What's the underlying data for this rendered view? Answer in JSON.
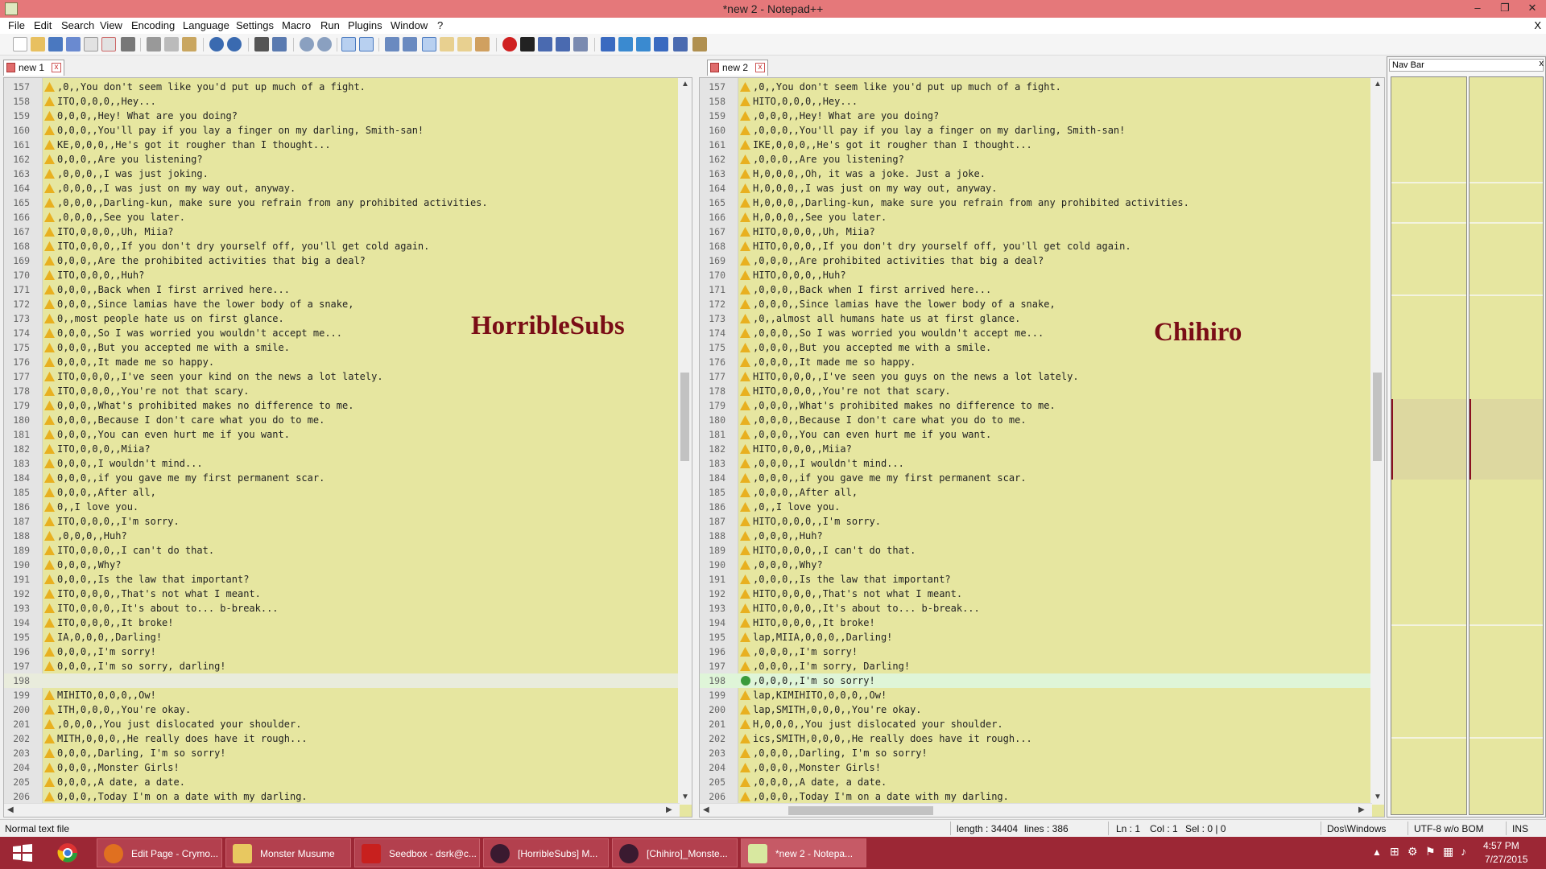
{
  "window": {
    "title": "*new  2 - Notepad++",
    "minimize": "–",
    "restore": "❐",
    "close": "✕"
  },
  "menu": {
    "items": [
      "File",
      "Edit",
      "Search",
      "View",
      "Encoding",
      "Language",
      "Settings",
      "Macro",
      "Run",
      "Plugins",
      "Window",
      "?"
    ],
    "close": "X"
  },
  "left": {
    "tab": "new  1",
    "overlay": "HorribleSubs",
    "lines": [
      {
        "n": "157",
        "t": ",0,,You don't seem like you'd put up much of a fight."
      },
      {
        "n": "158",
        "t": "ITO,0,0,0,,Hey..."
      },
      {
        "n": "159",
        "t": "0,0,0,,Hey! What are you doing?"
      },
      {
        "n": "160",
        "t": "0,0,0,,You'll pay if you lay a finger on my darling, Smith-san!"
      },
      {
        "n": "161",
        "t": "KE,0,0,0,,He's got it rougher than I thought..."
      },
      {
        "n": "162",
        "t": "0,0,0,,Are you listening?"
      },
      {
        "n": "163",
        "t": ",0,0,0,,I was just joking."
      },
      {
        "n": "164",
        "t": ",0,0,0,,I was just on my way out, anyway."
      },
      {
        "n": "165",
        "t": ",0,0,0,,Darling-kun, make sure you refrain from any prohibited activities."
      },
      {
        "n": "166",
        "t": ",0,0,0,,See you later."
      },
      {
        "n": "167",
        "t": "ITO,0,0,0,,Uh, Miia?"
      },
      {
        "n": "168",
        "t": "ITO,0,0,0,,If you don't dry yourself off, you'll get cold again."
      },
      {
        "n": "169",
        "t": "0,0,0,,Are the prohibited activities that big a deal?"
      },
      {
        "n": "170",
        "t": "ITO,0,0,0,,Huh?"
      },
      {
        "n": "171",
        "t": "0,0,0,,Back when I first arrived here..."
      },
      {
        "n": "172",
        "t": "0,0,0,,Since lamias have the lower body of a snake,"
      },
      {
        "n": "173",
        "t": "0,,most people hate us on first glance."
      },
      {
        "n": "174",
        "t": "0,0,0,,So I was worried you wouldn't accept me..."
      },
      {
        "n": "175",
        "t": "0,0,0,,But you accepted me with a smile."
      },
      {
        "n": "176",
        "t": "0,0,0,,It made me so happy."
      },
      {
        "n": "177",
        "t": "ITO,0,0,0,,I've seen your kind on the news a lot lately."
      },
      {
        "n": "178",
        "t": "ITO,0,0,0,,You're not that scary."
      },
      {
        "n": "179",
        "t": "0,0,0,,What's prohibited makes no difference to me."
      },
      {
        "n": "180",
        "t": "0,0,0,,Because I don't care what you do to me."
      },
      {
        "n": "181",
        "t": "0,0,0,,You can even hurt me if you want."
      },
      {
        "n": "182",
        "t": "ITO,0,0,0,,Miia?"
      },
      {
        "n": "183",
        "t": "0,0,0,,I wouldn't mind..."
      },
      {
        "n": "184",
        "t": "0,0,0,,if you gave me my first permanent scar."
      },
      {
        "n": "185",
        "t": "0,0,0,,After all,"
      },
      {
        "n": "186",
        "t": "0,,I love you."
      },
      {
        "n": "187",
        "t": "ITO,0,0,0,,I'm sorry."
      },
      {
        "n": "188",
        "t": ",0,0,0,,Huh?"
      },
      {
        "n": "189",
        "t": "ITO,0,0,0,,I can't do that."
      },
      {
        "n": "190",
        "t": "0,0,0,,Why?"
      },
      {
        "n": "191",
        "t": "0,0,0,,Is the law that important?"
      },
      {
        "n": "192",
        "t": "ITO,0,0,0,,That's not what I meant."
      },
      {
        "n": "193",
        "t": "ITO,0,0,0,,It's about to... b-break..."
      },
      {
        "n": "194",
        "t": "ITO,0,0,0,,It broke!"
      },
      {
        "n": "195",
        "t": "IA,0,0,0,,Darling!"
      },
      {
        "n": "196",
        "t": "0,0,0,,I'm sorry!"
      },
      {
        "n": "197",
        "t": "0,0,0,,I'm so sorry, darling!"
      },
      {
        "n": "198",
        "t": ""
      },
      {
        "n": "199",
        "t": "MIHITO,0,0,0,,Ow!"
      },
      {
        "n": "200",
        "t": "ITH,0,0,0,,You're okay."
      },
      {
        "n": "201",
        "t": ",0,0,0,,You just dislocated your shoulder."
      },
      {
        "n": "202",
        "t": "MITH,0,0,0,,He really does have it rough..."
      },
      {
        "n": "203",
        "t": "0,0,0,,Darling, I'm so sorry!"
      },
      {
        "n": "204",
        "t": "0,0,0,,Monster Girls!"
      },
      {
        "n": "205",
        "t": "0,0,0,,A date, a date."
      },
      {
        "n": "206",
        "t": "0,0,0,,Today I'm on a date with my darling."
      }
    ]
  },
  "right": {
    "tab": "new  2",
    "overlay": "Chihiro",
    "lines": [
      {
        "n": "157",
        "t": ",0,,You don't seem like you'd put up much of a fight."
      },
      {
        "n": "158",
        "t": "HITO,0,0,0,,Hey..."
      },
      {
        "n": "159",
        "t": ",0,0,0,,Hey! What are you doing?"
      },
      {
        "n": "160",
        "t": ",0,0,0,,You'll pay if you lay a finger on my darling, Smith-san!"
      },
      {
        "n": "161",
        "t": "IKE,0,0,0,,He's got it rougher than I thought..."
      },
      {
        "n": "162",
        "t": ",0,0,0,,Are you listening?"
      },
      {
        "n": "163",
        "t": "H,0,0,0,,Oh, it was a joke. Just a joke."
      },
      {
        "n": "164",
        "t": "H,0,0,0,,I was just on my way out, anyway."
      },
      {
        "n": "165",
        "t": "H,0,0,0,,Darling-kun, make sure you refrain from any prohibited activities."
      },
      {
        "n": "166",
        "t": "H,0,0,0,,See you later."
      },
      {
        "n": "167",
        "t": "HITO,0,0,0,,Uh, Miia?"
      },
      {
        "n": "168",
        "t": "HITO,0,0,0,,If you don't dry yourself off, you'll get cold again."
      },
      {
        "n": "169",
        "t": ",0,0,0,,Are prohibited activities that big a deal?"
      },
      {
        "n": "170",
        "t": "HITO,0,0,0,,Huh?"
      },
      {
        "n": "171",
        "t": ",0,0,0,,Back when I first arrived here..."
      },
      {
        "n": "172",
        "t": ",0,0,0,,Since lamias have the lower body of a snake,"
      },
      {
        "n": "173",
        "t": ",0,,almost all humans hate us at first glance."
      },
      {
        "n": "174",
        "t": ",0,0,0,,So I was worried you wouldn't accept me..."
      },
      {
        "n": "175",
        "t": ",0,0,0,,But you accepted me with a smile."
      },
      {
        "n": "176",
        "t": ",0,0,0,,It made me so happy."
      },
      {
        "n": "177",
        "t": "HITO,0,0,0,,I've seen you guys on the news a lot lately."
      },
      {
        "n": "178",
        "t": "HITO,0,0,0,,You're not that scary."
      },
      {
        "n": "179",
        "t": ",0,0,0,,What's prohibited makes no difference to me."
      },
      {
        "n": "180",
        "t": ",0,0,0,,Because I don't care what you do to me."
      },
      {
        "n": "181",
        "t": ",0,0,0,,You can even hurt me if you want."
      },
      {
        "n": "182",
        "t": "HITO,0,0,0,,Miia?"
      },
      {
        "n": "183",
        "t": ",0,0,0,,I wouldn't mind..."
      },
      {
        "n": "184",
        "t": ",0,0,0,,if you gave me my first permanent scar."
      },
      {
        "n": "185",
        "t": ",0,0,0,,After all,"
      },
      {
        "n": "186",
        "t": ",0,,I love you."
      },
      {
        "n": "187",
        "t": "HITO,0,0,0,,I'm sorry."
      },
      {
        "n": "188",
        "t": ",0,0,0,,Huh?"
      },
      {
        "n": "189",
        "t": "HITO,0,0,0,,I can't do that."
      },
      {
        "n": "190",
        "t": ",0,0,0,,Why?"
      },
      {
        "n": "191",
        "t": ",0,0,0,,Is the law that important?"
      },
      {
        "n": "192",
        "t": "HITO,0,0,0,,That's not what I meant."
      },
      {
        "n": "193",
        "t": "HITO,0,0,0,,It's about to... b-break..."
      },
      {
        "n": "194",
        "t": "HITO,0,0,0,,It broke!"
      },
      {
        "n": "195",
        "t": "lap,MIIA,0,0,0,,Darling!"
      },
      {
        "n": "196",
        "t": ",0,0,0,,I'm sorry!"
      },
      {
        "n": "197",
        "t": ",0,0,0,,I'm sorry, Darling!"
      },
      {
        "n": "198",
        "t": ",0,0,0,,I'm so sorry!"
      },
      {
        "n": "199",
        "t": "lap,KIMIHITO,0,0,0,,Ow!"
      },
      {
        "n": "200",
        "t": "lap,SMITH,0,0,0,,You're okay."
      },
      {
        "n": "201",
        "t": "H,0,0,0,,You just dislocated your shoulder."
      },
      {
        "n": "202",
        "t": "ics,SMITH,0,0,0,,He really does have it rough..."
      },
      {
        "n": "203",
        "t": ",0,0,0,,Darling, I'm so sorry!"
      },
      {
        "n": "204",
        "t": ",0,0,0,,Monster Girls!"
      },
      {
        "n": "205",
        "t": ",0,0,0,,A date, a date."
      },
      {
        "n": "206",
        "t": ",0,0,0,,Today I'm on a date with my darling."
      }
    ]
  },
  "navbar": {
    "title": "Nav Bar",
    "close": "x"
  },
  "status": {
    "filetype": "Normal text file",
    "length": "length : 34404",
    "lines": "lines : 386",
    "ln": "Ln : 1",
    "col": "Col : 1",
    "sel": "Sel : 0 | 0",
    "eol": "Dos\\Windows",
    "encoding": "UTF-8 w/o BOM",
    "mode": "INS"
  },
  "taskbar": {
    "items": [
      {
        "label": "Edit Page - Crymo..."
      },
      {
        "label": "Monster Musume"
      },
      {
        "label": "Seedbox - dsrk@c..."
      },
      {
        "label": "[HorribleSubs] M..."
      },
      {
        "label": "[Chihiro]_Monste..."
      },
      {
        "label": "*new  2 - Notepa..."
      }
    ],
    "time": "4:57 PM",
    "date": "7/27/2015"
  },
  "colors": {
    "editor_bg": "#e6e6a0",
    "title_bg": "#e5787a",
    "taskbar_bg": "#9c2735",
    "overlay": "#7a0d16"
  }
}
